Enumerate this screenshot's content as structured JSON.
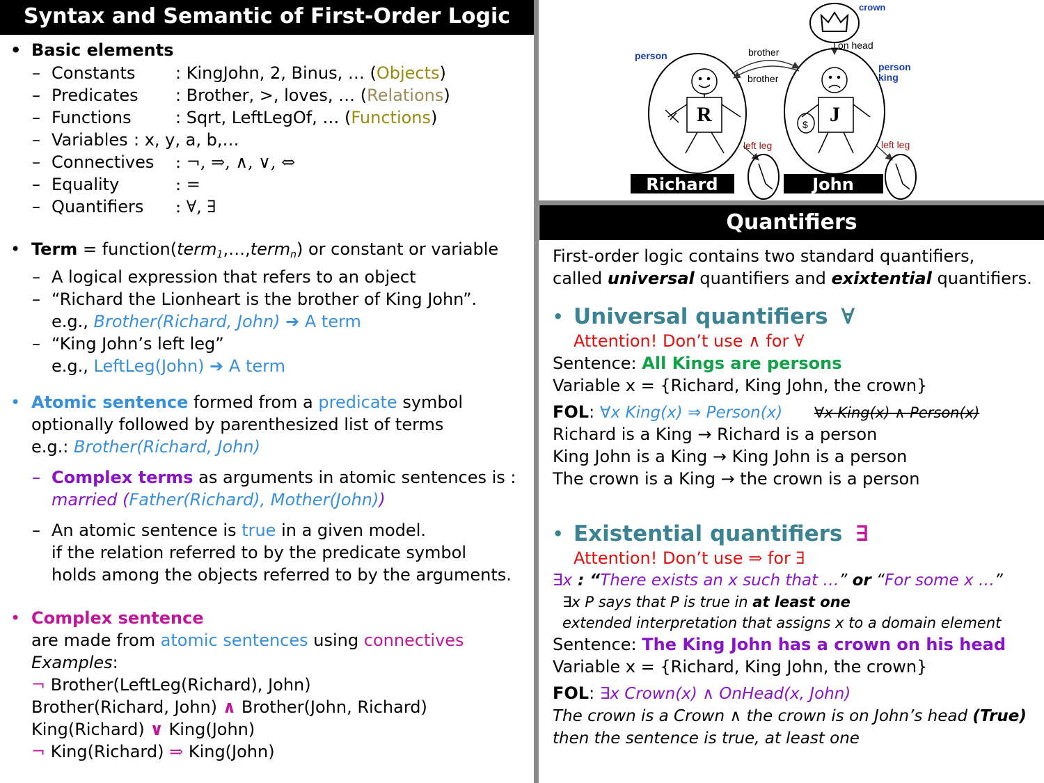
{
  "left_title": "Syntax and Semantic of First-Order Logic",
  "basic": {
    "heading": "Basic elements",
    "rows": [
      {
        "label": "Constants",
        "text": ": KingJohn, 2, Binus, … (",
        "tag": "Objects",
        "close": ")"
      },
      {
        "label": "Predicates",
        "text": ": Brother, >, loves, … (",
        "tag": "Relations",
        "close": ")"
      },
      {
        "label": "Functions",
        "text": ": Sqrt, LeftLegOf, … (",
        "tag": "Functions",
        "close": ")"
      },
      {
        "label": "Variables",
        "text": ": x, y, a, b,…",
        "tag": "",
        "close": ""
      },
      {
        "label": "Connectives",
        "text": ": ¬, ⇒, ∧, ∨, ⇔",
        "tag": "",
        "close": ""
      },
      {
        "label": "Equality",
        "text": ": =",
        "tag": "",
        "close": ""
      },
      {
        "label": "Quantifiers",
        "text": ": ∀, ∃",
        "tag": "",
        "close": ""
      }
    ]
  },
  "term": {
    "heading": "Term",
    "def_a": " = function(",
    "def_term": "term",
    "def_sub1": "1",
    "def_mid": ",…,",
    "def_subn": "n",
    "def_b": ") or constant or variable",
    "l1": "A logical expression that refers to an object",
    "l2": "“Richard the Lionheart is the brother of King John”.",
    "eg1_pre": "e.g., ",
    "eg1_expr": "Brother(Richard, John)",
    "eg1_arrow": " ➔ A term",
    "l3": "“King John’s left leg”",
    "eg2_pre": "e.g., ",
    "eg2_expr": "LeftLeg(John)",
    "eg2_arrow": " ➔ A term"
  },
  "atomic": {
    "heading": "Atomic sentence",
    "t1": " formed from a ",
    "t1_pred": "predicate",
    "t1_end": " symbol",
    "t2": "optionally followed by parenthesized list of terms",
    "eg_pre": "e.g.: ",
    "eg_expr": "Brother(Richard, John)",
    "complex_terms": "Complex terms",
    "ct_rest": " as arguments in atomic sentences is :",
    "ct_m": "married (",
    "ct_args": "Father(Richard), Mother(John)",
    "ct_close": ")",
    "tr1_a": "An atomic sentence is ",
    "tr1_true": "true",
    "tr1_b": " in a given model.",
    "tr2": "if the relation referred to by the predicate symbol",
    "tr3": "holds among the objects referred to by the arguments."
  },
  "complex": {
    "heading": "Complex sentence",
    "l1_a": "are made from ",
    "l1_atomic": "atomic sentences",
    "l1_b": " using ",
    "l1_conn": "connectives",
    "examples": "Examples",
    "colon": ":",
    "e1_sym": "¬",
    "e1_text": " Brother(LeftLeg(Richard), John)",
    "e2_a": "Brother(Richard, John) ",
    "e2_sym": "∧",
    "e2_b": " Brother(John, Richard)",
    "e3_a": "King(Richard) ",
    "e3_sym": "∨",
    "e3_b": " King(John)",
    "e4_sym1": "¬",
    "e4_a": " King(Richard) ",
    "e4_sym2": "⇒",
    "e4_b": " King(John)"
  },
  "diagram": {
    "crown_label": "crown",
    "on_head": "on head",
    "brother_top": "brother",
    "brother_bottom": "brother",
    "person_left": "person",
    "person_right": "person",
    "king_right": "king",
    "left_leg_1": "left leg",
    "left_leg_2": "left leg",
    "letter_r": "R",
    "letter_j": "J",
    "money": "$",
    "name_richard": "Richard",
    "name_john": "John"
  },
  "quant": {
    "title": "Quantifiers",
    "intro1": "First-order logic contains two standard quantifiers,",
    "intro2_a": "called ",
    "intro2_u": "universal",
    "intro2_b": " quantifiers and ",
    "intro2_e": "exixtential",
    "intro2_c": " quantifiers.",
    "uni_heading": "Universal quantifiers",
    "uni_sym": "∀",
    "uni_att_a": "Attention!  Don’t use ",
    "uni_att_sym": "∧",
    "uni_att_b": " for ",
    "uni_att_sym2": "∀",
    "uni_sent_label": "Sentence: ",
    "uni_sent": "All Kings are persons",
    "uni_var": "Variable x = {Richard, King John, the crown}",
    "uni_fol_label": "FOL",
    "uni_fol_colon": ":",
    "uni_fol_expr": "∀x  King(x) ⇒ Person(x)",
    "uni_fol_wrong": "∀x  King(x) ∧ Person(x)",
    "uni_r1": "Richard is a King → Richard is a person",
    "uni_r2": "King John is a King → King John is a person",
    "uni_r3": "The crown is a King → the crown is a person",
    "ex_heading": "Existential quantifiers",
    "ex_sym": "∃",
    "ex_att_a": "Attention!  Don’t use ",
    "ex_att_sym": "⇒",
    "ex_att_b": " for ",
    "ex_att_sym2": "∃",
    "ex_def_x": "∃x",
    "ex_def_colon": " : “",
    "ex_def_q1": "There exists an x such that …",
    "ex_def_mid": "” ",
    "ex_def_or": "or",
    "ex_def_open": " “",
    "ex_def_q2": "For some x …",
    "ex_def_close": "”",
    "ex_says_a": "∃x P says that P is true in ",
    "ex_says_b": "at least one",
    "ex_ext": "extended interpretation that assigns x to a domain element",
    "ex_sent_label": "Sentence:  ",
    "ex_sent": "The King John has a crown on his head",
    "ex_var": "Variable x = {Richard, King John, the crown}",
    "ex_fol_label": "FOL",
    "ex_fol_colon": ":",
    "ex_fol_expr": "∃x  Crown(x) ∧ OnHead(x, John)",
    "ex_r1_a": "The crown is a Crown ∧ the crown is on John’s head ",
    "ex_r1_b": "(True)",
    "ex_r2": "then the sentence is true, at least one"
  }
}
